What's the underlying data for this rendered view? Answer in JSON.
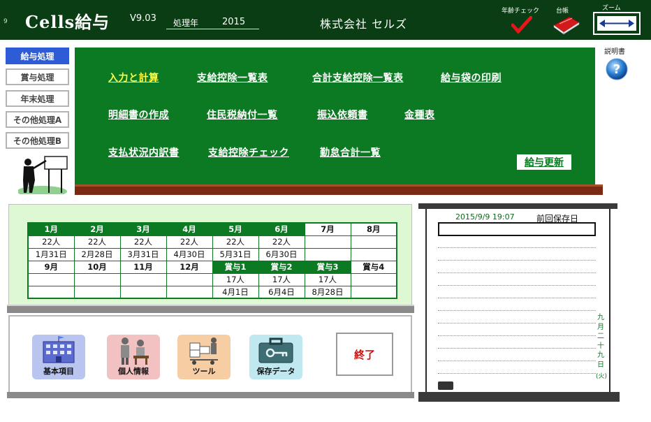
{
  "header": {
    "small_text": "9",
    "title": "Cells給与",
    "version": "V9.03",
    "year_label": "処理年",
    "year_value": "2015",
    "company": "株式会社 セルズ",
    "age_check_label": "年齢チェック",
    "ledger_label": "台帳",
    "zoom_label": "ズーム"
  },
  "sidebar": {
    "items": [
      {
        "label": "給与処理",
        "active": true
      },
      {
        "label": "賞与処理",
        "active": false
      },
      {
        "label": "年末処理",
        "active": false
      },
      {
        "label": "その他処理A",
        "active": false
      },
      {
        "label": "その他処理B",
        "active": false
      }
    ]
  },
  "board": {
    "links": [
      "入力と計算",
      "支給控除一覧表",
      "合計支給控除一覧表",
      "給与袋の印刷",
      "明細書の作成",
      "住民税納付一覧",
      "振込依頼書",
      "金種表",
      "支払状況内訳書",
      "支給控除チェック",
      "勤怠合計一覧"
    ],
    "update_label": "給与更新"
  },
  "manual_label": "説明書",
  "calendar": {
    "row1": [
      "1月",
      "2月",
      "3月",
      "4月",
      "5月",
      "6月",
      "7月",
      "8月"
    ],
    "row2": [
      "22人",
      "22人",
      "22人",
      "22人",
      "22人",
      "22人",
      "",
      ""
    ],
    "row3": [
      "1月31日",
      "2月28日",
      "3月31日",
      "4月30日",
      "5月31日",
      "6月30日",
      "",
      ""
    ],
    "row4": [
      "9月",
      "10月",
      "11月",
      "12月",
      "賞与1",
      "賞与2",
      "賞与3",
      "賞与4"
    ],
    "row5": [
      "",
      "",
      "",
      "",
      "17人",
      "17人",
      "17人",
      ""
    ],
    "row6": [
      "",
      "",
      "",
      "",
      "4月1日",
      "6月4日",
      "8月28日",
      ""
    ]
  },
  "tools": {
    "basic_label": "基本項目",
    "personal_label": "個人情報",
    "tool_label": "ツール",
    "save_label": "保存データ",
    "exit_label": "終了"
  },
  "note": {
    "saved_datetime": "2015/9/9 19:07",
    "last_saved_label": "前回保存日",
    "vertical_date": [
      "九",
      "月",
      "二",
      "十",
      "九",
      "日",
      "(火)"
    ]
  },
  "colors": {
    "header_bg": "#0a3d14",
    "board_green": "#0c7a22",
    "active_blue": "#2e5cd6",
    "highlight_link": "#ffff44",
    "exit_red": "#cc1111"
  }
}
